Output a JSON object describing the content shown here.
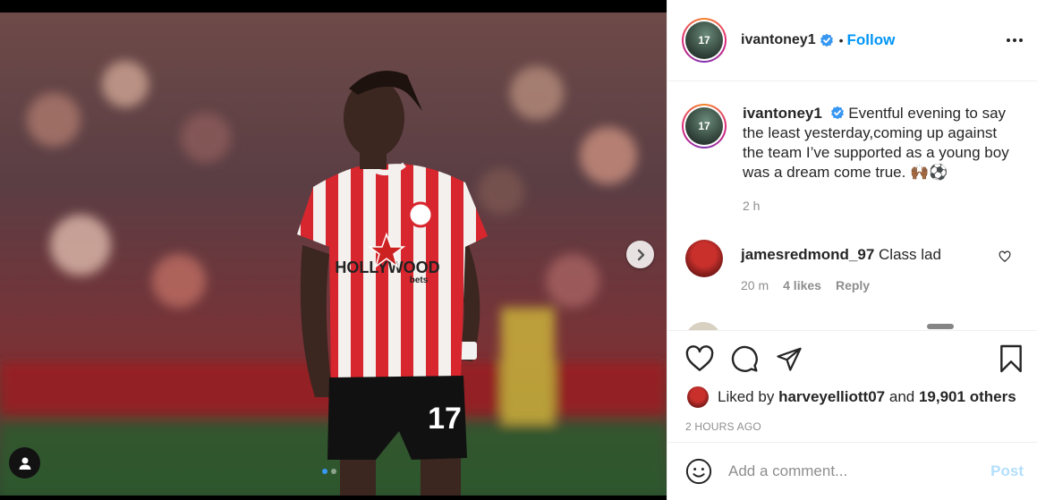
{
  "post": {
    "username": "ivantoney1",
    "follow_label": "Follow",
    "follow_separator": "•",
    "avatar_jersey_number": "17"
  },
  "photo": {
    "jersey_number": "17",
    "sponsor_line1": "HOLLYWOOD",
    "sponsor_line2": "bets",
    "carousel_total": 2,
    "carousel_active": 1
  },
  "caption": {
    "username": "ivantoney1",
    "text": "Eventful evening to say the least yesterday,coming up against the team I’ve supported as a young boy was a dream come true. 🙌🏾⚽️",
    "time": "2 h"
  },
  "comments": [
    {
      "username": "jamesredmond_97",
      "text": "Class lad",
      "time": "20 m",
      "likes": "4 likes",
      "reply_label": "Reply"
    }
  ],
  "likes": {
    "prefix": "Liked by",
    "user": "harveyelliott07",
    "joiner": "and",
    "others": "19,901 others"
  },
  "timestamp": "2 HOURS AGO",
  "comment_box": {
    "placeholder": "Add a comment...",
    "post_label": "Post"
  },
  "colors": {
    "follow": "#0095f6",
    "post_disabled": "#b2dffc",
    "muted": "#8e8e8e",
    "text": "#262626"
  },
  "icons": [
    "user-tag-icon",
    "chevron-right-icon",
    "verified-badge-icon",
    "more-options-icon",
    "heart-icon",
    "comment-icon",
    "share-icon",
    "save-icon",
    "emoji-icon"
  ]
}
